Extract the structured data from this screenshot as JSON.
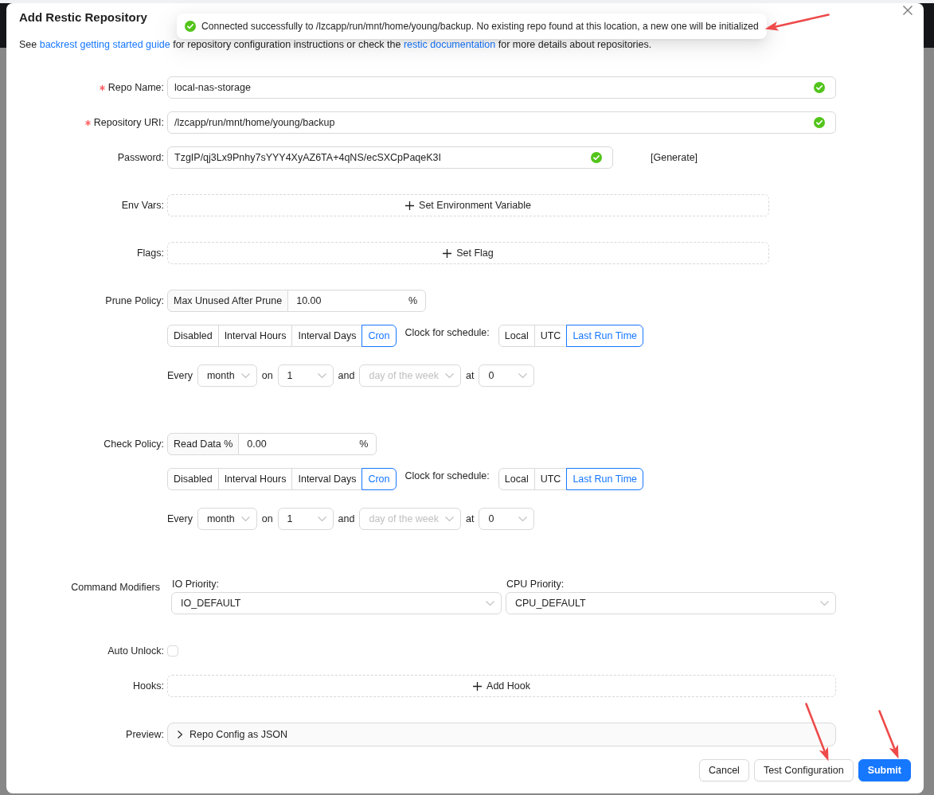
{
  "dialog": {
    "title": "Add Restic Repository"
  },
  "intro": [
    {
      "kind": "text",
      "text": "See "
    },
    {
      "kind": "link",
      "text": "backrest getting started guide"
    },
    {
      "kind": "text",
      "text": " for repository configuration instructions or check the "
    },
    {
      "kind": "link",
      "text": "restic documentation"
    },
    {
      "kind": "text",
      "text": " for more details about repositories."
    }
  ],
  "toast": {
    "kind": "success",
    "text": "Connected successfully to /lzcapp/run/mnt/home/young/backup. No existing repo found at this location, a new one will be initialized"
  },
  "repo_name": {
    "label": "Repo Name:",
    "required": true,
    "value": "local-nas-storage",
    "valid": true
  },
  "repository_uri": {
    "label": "Repository URI:",
    "required": true,
    "value": "/lzcapp/run/mnt/home/young/backup",
    "valid": true
  },
  "password": {
    "label": "Password:",
    "value": "TzgIP/qj3Lx9Pnhy7sYYY4XyAZ6TA+4qNS/ecSXCpPaqeK3I",
    "valid": true,
    "action": "[Generate]"
  },
  "env_vars": {
    "label": "Env Vars:",
    "button": "Set Environment Variable"
  },
  "flags": {
    "label": "Flags:",
    "button": "Set Flag"
  },
  "prune_policy": {
    "label": "Prune Policy:",
    "addon": "Max Unused After Prune",
    "value": "10.00",
    "suffix": "%",
    "modes": [
      {
        "label": "Disabled",
        "selected": false
      },
      {
        "label": "Interval Hours",
        "selected": false
      },
      {
        "label": "Interval Days",
        "selected": false
      },
      {
        "label": "Cron",
        "selected": true
      }
    ],
    "clock_label": "Clock for schedule:",
    "clocks": [
      {
        "label": "Local",
        "selected": false
      },
      {
        "label": "UTC",
        "selected": false
      },
      {
        "label": "Last Run Time",
        "selected": true
      }
    ],
    "schedule": [
      {
        "kind": "text",
        "text": "Every"
      },
      {
        "kind": "select",
        "value": "month"
      },
      {
        "kind": "text",
        "text": "on"
      },
      {
        "kind": "select",
        "value": "1"
      },
      {
        "kind": "text",
        "text": "and"
      },
      {
        "kind": "select",
        "placeholder": "day of the week"
      },
      {
        "kind": "text",
        "text": "at"
      },
      {
        "kind": "select",
        "value": "0"
      }
    ]
  },
  "check_policy": {
    "label": "Check Policy:",
    "addon": "Read Data %",
    "value": "0.00",
    "suffix": "%",
    "modes": [
      {
        "label": "Disabled",
        "selected": false
      },
      {
        "label": "Interval Hours",
        "selected": false
      },
      {
        "label": "Interval Days",
        "selected": false
      },
      {
        "label": "Cron",
        "selected": true
      }
    ],
    "clock_label": "Clock for schedule:",
    "clocks": [
      {
        "label": "Local",
        "selected": false
      },
      {
        "label": "UTC",
        "selected": false
      },
      {
        "label": "Last Run Time",
        "selected": true
      }
    ],
    "schedule": [
      {
        "kind": "text",
        "text": "Every"
      },
      {
        "kind": "select",
        "value": "month"
      },
      {
        "kind": "text",
        "text": "on"
      },
      {
        "kind": "select",
        "value": "1"
      },
      {
        "kind": "text",
        "text": "and"
      },
      {
        "kind": "select",
        "placeholder": "day of the week"
      },
      {
        "kind": "text",
        "text": "at"
      },
      {
        "kind": "select",
        "value": "0"
      }
    ]
  },
  "command_modifiers": {
    "label": "Command Modifiers",
    "selects": [
      {
        "label": "IO Priority:",
        "value": "IO_DEFAULT"
      },
      {
        "label": "CPU Priority:",
        "value": "CPU_DEFAULT"
      }
    ]
  },
  "auto_unlock": {
    "label": "Auto Unlock:",
    "checked": false
  },
  "hooks": {
    "label": "Hooks:",
    "button": "Add Hook"
  },
  "preview": {
    "label": "Preview:",
    "title": "Repo Config as JSON",
    "expanded": false
  },
  "footer": {
    "buttons": [
      {
        "label": "Cancel",
        "kind": "default"
      },
      {
        "label": "Test Configuration",
        "kind": "default"
      },
      {
        "label": "Submit",
        "kind": "primary"
      }
    ]
  }
}
